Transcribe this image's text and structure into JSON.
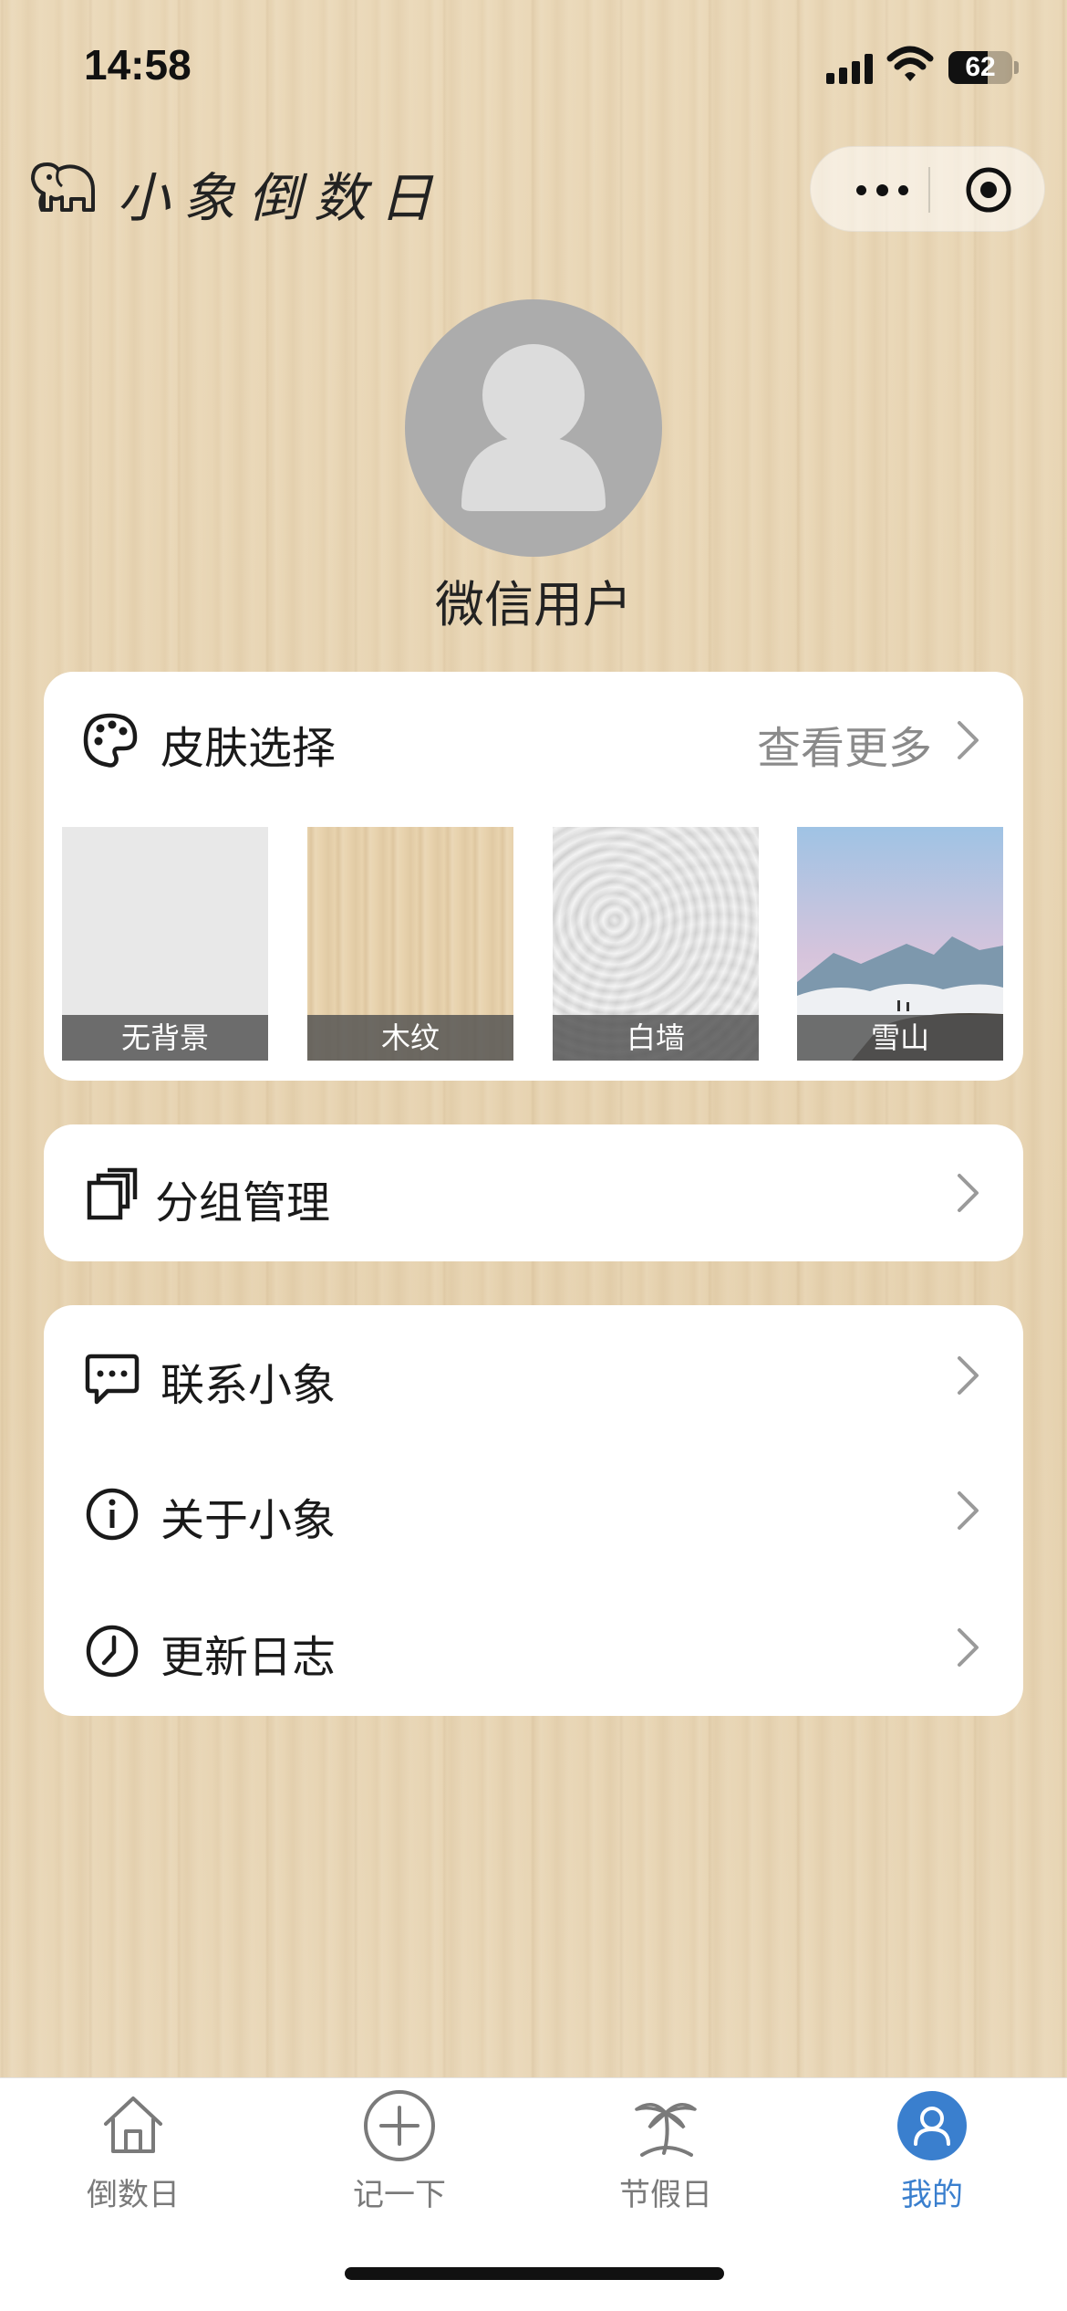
{
  "status_bar": {
    "time": "14:58",
    "battery": "62"
  },
  "header": {
    "title": "小象倒数日",
    "logo_icon": "elephant-icon",
    "more_icon": "more-dots-icon",
    "close_icon": "target-close-icon"
  },
  "profile": {
    "username": "微信用户",
    "avatar_icon": "default-avatar-icon"
  },
  "skin": {
    "title": "皮肤选择",
    "see_more": "查看更多",
    "items": [
      {
        "label": "无背景"
      },
      {
        "label": "木纹"
      },
      {
        "label": "白墙"
      },
      {
        "label": "雪山"
      }
    ]
  },
  "group": {
    "label": "分组管理"
  },
  "menu": [
    {
      "label": "联系小象",
      "icon": "chat-bubble-icon"
    },
    {
      "label": "关于小象",
      "icon": "info-icon"
    },
    {
      "label": "更新日志",
      "icon": "clock-icon"
    }
  ],
  "tabbar": [
    {
      "label": "倒数日",
      "icon": "home-icon"
    },
    {
      "label": "记一下",
      "icon": "plus-circle-icon"
    },
    {
      "label": "节假日",
      "icon": "palm-tree-icon"
    },
    {
      "label": "我的",
      "icon": "user-icon",
      "active": true
    }
  ],
  "colors": {
    "accent": "#3a7fce",
    "card": "#ffffff",
    "text": "#1a1a1a",
    "muted": "#8a8a8a"
  }
}
